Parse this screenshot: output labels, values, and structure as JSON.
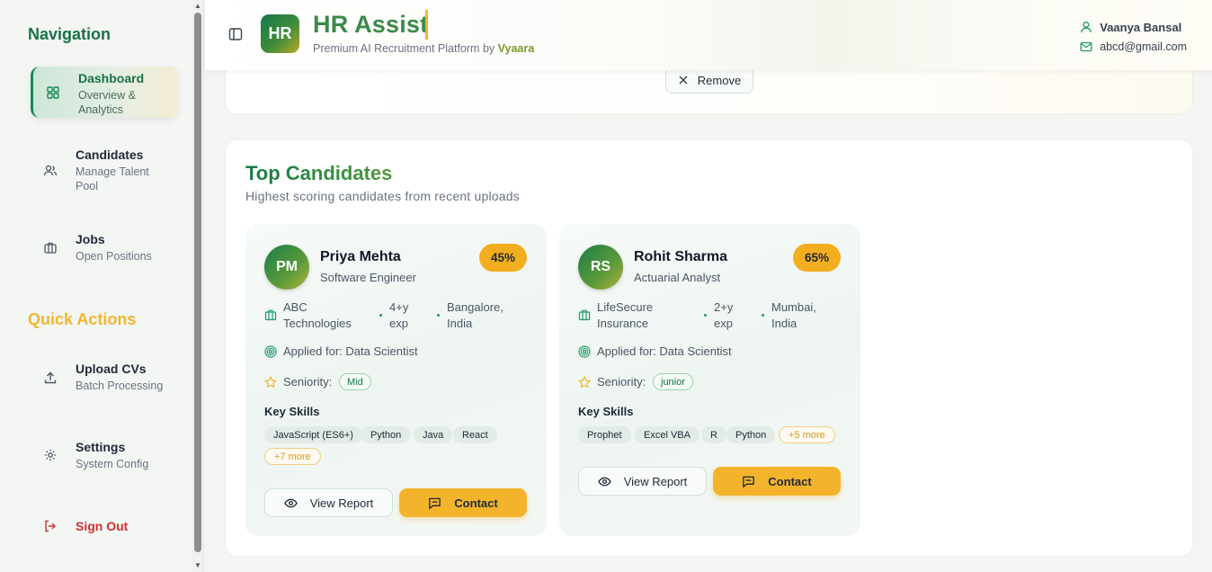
{
  "sidebar": {
    "nav_heading": "Navigation",
    "quick_heading": "Quick Actions",
    "items": [
      {
        "label": "Dashboard",
        "sub": "Overview &\nAnalytics",
        "icon": "grid-icon"
      },
      {
        "label": "Candidates",
        "sub": "Manage Talent Pool",
        "icon": "users-icon"
      },
      {
        "label": "Jobs",
        "sub": "Open Positions",
        "icon": "briefcase-icon"
      }
    ],
    "actions": [
      {
        "label": "Upload CVs",
        "sub": "Batch Processing",
        "icon": "upload-icon"
      },
      {
        "label": "Settings",
        "sub": "System Config",
        "icon": "gear-icon"
      }
    ],
    "signout": "Sign Out"
  },
  "header": {
    "logo": "HR",
    "title": "HR Assist",
    "subtitle": "Premium AI Recruitment Platform by",
    "brand": "Vyaara",
    "user_name": "Vaanya Bansal",
    "user_email": "abcd@gmail.com"
  },
  "upload_card": {
    "remove_label": "Remove"
  },
  "top_candidates": {
    "title": "Top Candidates",
    "subtitle": "Highest scoring candidates from recent uploads",
    "applied_prefix": "Applied for:",
    "seniority_label": "Seniority:",
    "skills_title": "Key Skills",
    "view_label": "View Report",
    "contact_label": "Contact",
    "candidates": [
      {
        "initials": "PM",
        "name": "Priya Mehta",
        "role": "Software Engineer",
        "score": "45%",
        "company": "ABC Technologies",
        "experience": "4+y exp",
        "location": "Bangalore, India",
        "applied_for": "Applied for: Data Scientist",
        "seniority": "Mid",
        "skills": [
          "JavaScript (ES6+)",
          "Python",
          "Java",
          "React"
        ],
        "more": "+7 more"
      },
      {
        "initials": "RS",
        "name": "Rohit Sharma",
        "role": "Actuarial Analyst",
        "score": "65%",
        "company": "LifeSecure Insurance",
        "experience": "2+y exp",
        "location": "Mumbai, India",
        "applied_for": "Applied for: Data Scientist",
        "seniority": "junior",
        "skills": [
          "Prophet",
          "Excel VBA",
          "R",
          "Python"
        ],
        "more": "+5 more"
      }
    ]
  },
  "colors": {
    "primary": "#177245",
    "accent": "#f3b42b",
    "danger": "#d03030"
  }
}
